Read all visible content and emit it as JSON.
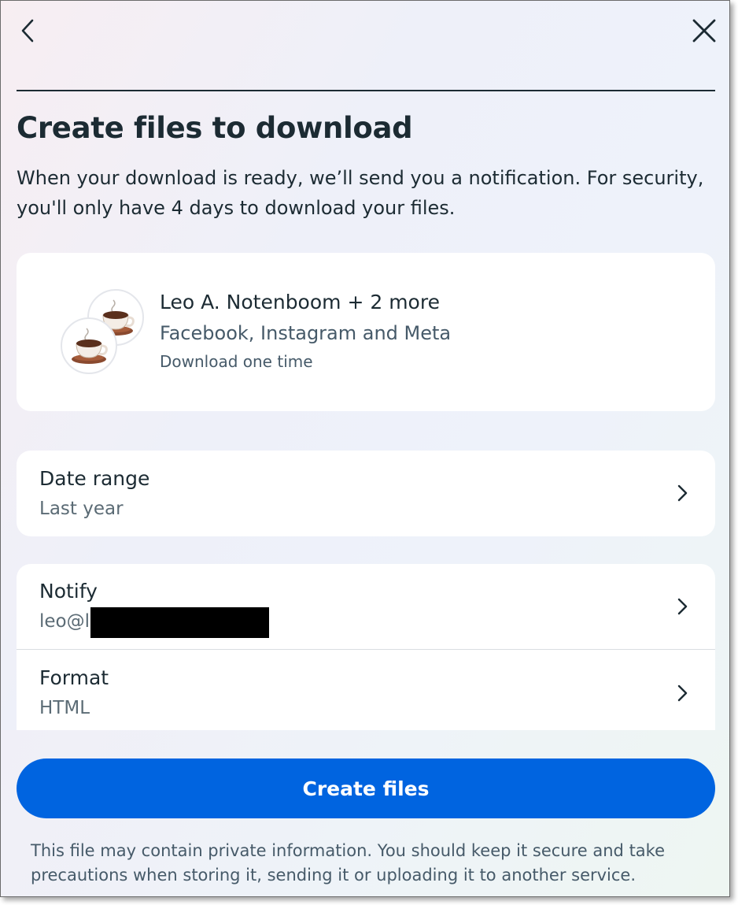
{
  "nav": {
    "back_icon": "chevron-left-icon",
    "close_icon": "close-icon"
  },
  "header": {
    "title": "Create files to download",
    "description": "When your download is ready, we’ll send you a notification. For security, you'll only have 4 days to download your files."
  },
  "account_card": {
    "name": "Leo A. Notenboom + 2 more",
    "apps": "Facebook, Instagram and Meta",
    "frequency": "Download one time",
    "avatar_icon": "coffee-cup-icon"
  },
  "settings": {
    "date_range": {
      "label": "Date range",
      "value": "Last year"
    },
    "notify": {
      "label": "Notify",
      "value": "leo@l"
    },
    "format": {
      "label": "Format",
      "value": "HTML"
    }
  },
  "footer": {
    "create_button": "Create files",
    "disclaimer": "This file may contain private information. You should keep it secure and take precautions when storing it, sending it or uploading it to another service."
  },
  "colors": {
    "primary": "#0064e0",
    "text": "#1c2b33",
    "secondary_text": "#465a69"
  }
}
